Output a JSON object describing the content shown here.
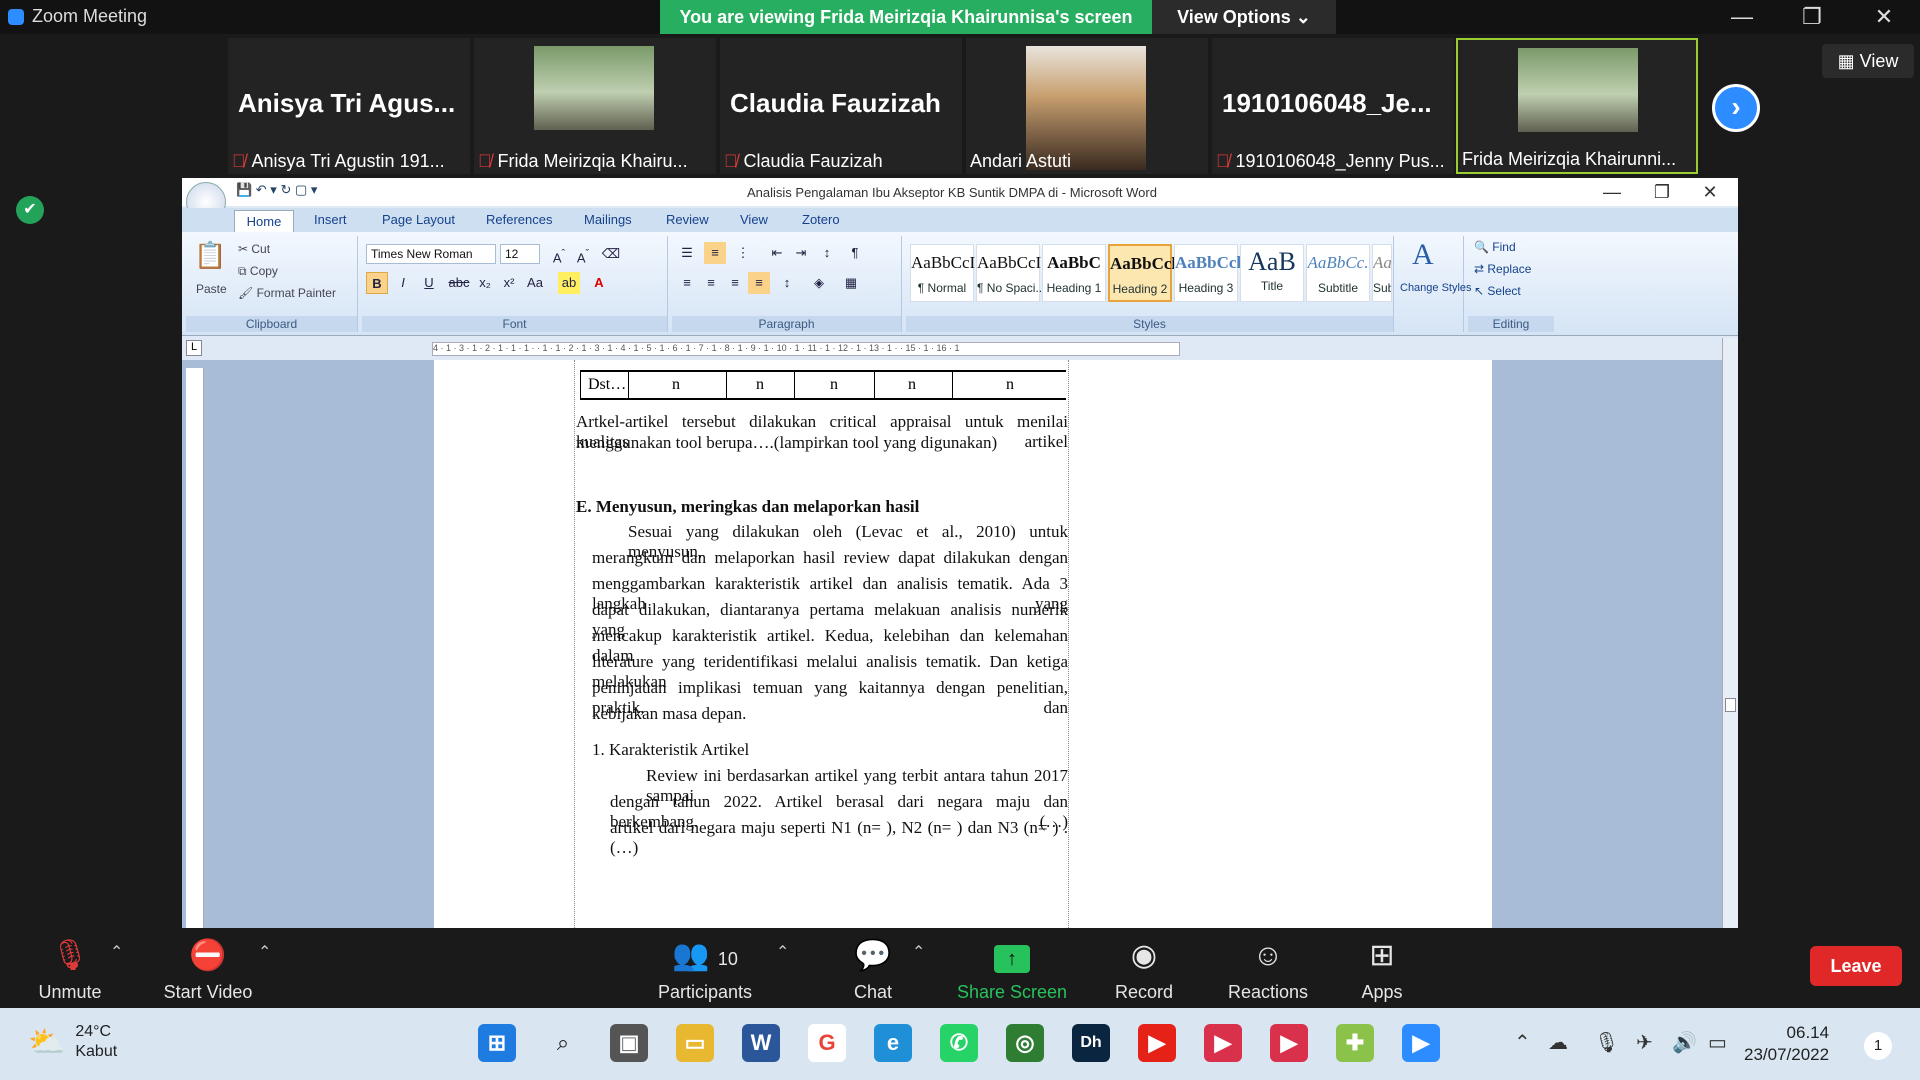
{
  "zoom": {
    "window_title": "Zoom Meeting",
    "viewing_banner": "You are viewing Frida Meirizqia Khairunnisa's screen",
    "view_options": "View Options ⌄",
    "view_button": "View",
    "window_controls": {
      "minimize": "—",
      "restore": "❐",
      "close": "✕"
    },
    "next_page": "›",
    "thumbnails": [
      {
        "big_name": "Anisya  Tri  Agus...",
        "label": "Anisya Tri Agustin 191...",
        "muted": true
      },
      {
        "big_name": "",
        "label": "Frida Meirizqia Khairu...",
        "muted": true
      },
      {
        "big_name": "Claudia Fauzizah",
        "label": "Claudia Fauzizah",
        "muted": true
      },
      {
        "big_name": "",
        "label": "Andari Astuti",
        "muted": false
      },
      {
        "big_name": "1910106048_Je...",
        "label": "1910106048_Jenny Pus...",
        "muted": true
      },
      {
        "big_name": "",
        "label": "Frida Meirizqia Khairunni...",
        "muted": false
      }
    ],
    "toolbar": {
      "unmute": "Unmute",
      "start_video": "Start Video",
      "participants": "Participants",
      "participants_count": "10",
      "chat": "Chat",
      "share_screen": "Share Screen",
      "record": "Record",
      "reactions": "Reactions",
      "apps": "Apps",
      "leave": "Leave"
    },
    "accent": "#2d8cff",
    "banner_color": "#27ae60",
    "leave_color": "#e02828"
  },
  "word": {
    "title": "Analisis Pengalaman Ibu Akseptor KB Suntik DMPA di  -  Microsoft Word",
    "tabs": [
      "Home",
      "Insert",
      "Page Layout",
      "References",
      "Mailings",
      "Review",
      "View",
      "Zotero"
    ],
    "clipboard": {
      "paste": "Paste",
      "cut": "Cut",
      "copy": "Copy",
      "format_painter": "Format Painter",
      "group": "Clipboard"
    },
    "font": {
      "name": "Times New Roman",
      "size": "12",
      "group": "Font"
    },
    "paragraph_group": "Paragraph",
    "styles": [
      {
        "preview": "AaBbCcI",
        "name": "¶ Normal"
      },
      {
        "preview": "AaBbCcI",
        "name": "¶ No Spaci..."
      },
      {
        "preview": "AaBbC",
        "name": "Heading 1"
      },
      {
        "preview": "AaBbCcl",
        "name": "Heading 2"
      },
      {
        "preview": "AaBbCcl",
        "name": "Heading 3"
      },
      {
        "preview": "AaB",
        "name": "Title"
      },
      {
        "preview": "AaBbCc.",
        "name": "Subtitle"
      },
      {
        "preview": "AaBbCcD",
        "name": "Subtle Em..."
      }
    ],
    "styles_group": "Styles",
    "change_styles": "Change Styles",
    "editing": {
      "find": "Find",
      "replace": "Replace",
      "select": "Select",
      "group": "Editing"
    },
    "ruler_text": "4 · 1 · 3 · 1 · 2 · 1 · 1 · 1 ·   · 1 · 1 · 2 · 1 · 3 · 1 · 4 · 1 · 5 · 1 · 6 · 1 · 7 · 1 · 8 · 1 · 9 · 1 · 10 · 1 · 11 · 1 · 12 · 1 · 13 · 1 ·   · 15 · 1 · 16 · 1",
    "document": {
      "table_row": [
        "Dst…",
        "n",
        "n",
        "n",
        "n",
        "n"
      ],
      "para1_line1": "Artkel-artikel  tersebut  dilakukan  critical  appraisal  untuk  menilai  kualitas  artikel",
      "para1_line2": "menggunakan tool berupa….(lampirkan tool yang digunakan)",
      "heading_e": "E. Menyusun,  meringkas  dan melaporkan  hasil",
      "para2": [
        "Sesuai  yang  dilakukan  oleh  (Levac  et  al.,  2010)  untuk  menyusun,",
        "merangkum  dan  melaporkan  hasil  review  dapat  dilakukan  dengan",
        "menggambarkan karakteristik artikel dan analisis tematik. Ada 3 langkah yang",
        "dapat  dilakukan,  diantaranya  pertama  melakuan  analisis  numerik  yang",
        "mencakup  karakteristik  artikel.  Kedua,  kelebihan  dan  kelemahan  dalam",
        "literature yang teridentifikasi melalui analisis tematik. Dan ketiga melakukan",
        "peninjauan  implikasi  temuan  yang  kaitannya  dengan  penelitian,  praktik,  dan",
        "kebijakan masa depan."
      ],
      "list_item": "1.  Karakteristik Artikel",
      "para3": [
        "Review  ini  berdasarkan  artikel  yang  terbit  antara  tahun  2017  sampai",
        "dengan  tahun  2022.  Artikel berasal dari negara maju dan berkembang. (…)",
        "artikel  dari  negara  maju  seperti  N1  (n=   ),  N2  (n= )  dan  N3  (n= ) . (…)"
      ]
    }
  },
  "taskbar": {
    "temperature": "24°C",
    "weather": "Kabut",
    "time": "06.14",
    "date": "23/07/2022",
    "notifications": "1"
  }
}
